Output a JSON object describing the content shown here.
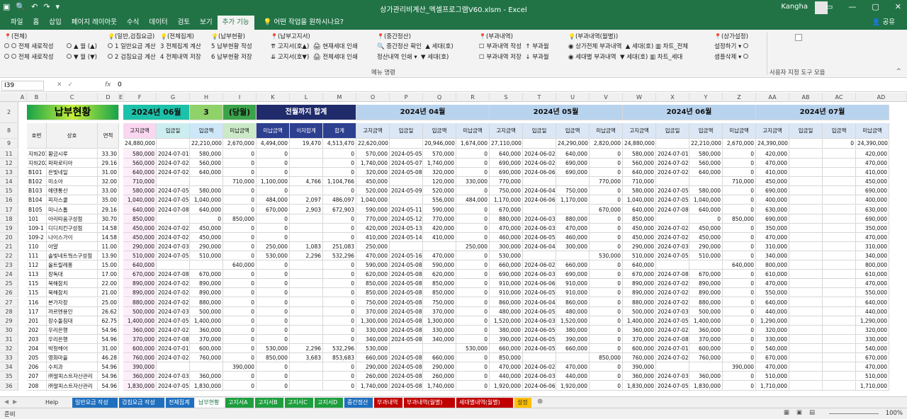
{
  "window": {
    "title": "상가관리비계산_엑셀프로그램V60.xlsm  -  Excel",
    "user": "Kangha"
  },
  "ribbon_tabs": [
    "파일",
    "홈",
    "삽입",
    "페이지 레이아웃",
    "수식",
    "데이터",
    "검토",
    "보기",
    "추가 기능"
  ],
  "tell_me": "어떤 작업을 원하시나요?",
  "share": "공유",
  "ribbon": {
    "row0": [
      "(전체)",
      "(일반,검침요금)",
      "(전체집계)",
      "(납부현황)",
      "(납부고지서)",
      "(중간정산)",
      "(부과내역)",
      "(부과내역(월별))",
      "(상가설정)"
    ],
    "row1": [
      "전체 새로작성",
      "월 (▲)",
      "1 일반요금 계산",
      "3 전체집계 계산",
      "5 납부현황 작성",
      "고지서(호▲)",
      "현재세대 인쇄",
      "중간정산 확인",
      "세대(호)",
      "부과내역 작성",
      "부과월",
      "상가전체 부과내역",
      "세대(호)",
      "차트_전체",
      "설정하기"
    ],
    "row2": [
      "전체 새로작성",
      "월 (▼)",
      "2 검침요금 계산",
      "4 전체내역 저장",
      "6 납부현황 저장",
      "고지서(호▼)",
      "전체세대 인쇄",
      "정산내역 인쇄",
      "세대(호)",
      "부과내역 저장",
      "부과월",
      "세대별 부과내역",
      "세대(호)",
      "차트_세대",
      "샘플삭제"
    ],
    "menu_label": "메뉴 명령",
    "custom_label": "사용자 지정 도구 모음"
  },
  "namebox": "I39",
  "formula": "0",
  "columns": [
    "A",
    "B",
    "C",
    "D",
    "E",
    "F",
    "G",
    "H",
    "I",
    "K",
    "L",
    "M",
    "O",
    "P",
    "Q",
    "R",
    "S",
    "T",
    "U",
    "V",
    "W",
    "X",
    "Y",
    "Z",
    "AA",
    "AB",
    "AC",
    "AD"
  ],
  "header": {
    "title": "납부현황",
    "month_label": "2024년 06월",
    "month_no": "3",
    "current": "(당월)",
    "total_label": "전월까지 합계",
    "m1": "2024년 04월",
    "m2": "2024년 05월",
    "m3": "2024년 06월",
    "m4": "2024년 07월"
  },
  "subhead": {
    "ho": "호번",
    "name": "상호",
    "area": "면적",
    "cols": [
      "고지금액",
      "입금일",
      "입금액",
      "미납금액"
    ],
    "tot": [
      "미납금액",
      "이자합계",
      "합계"
    ]
  },
  "totals": {
    "f": "24,880,000",
    "h": "22,210,000",
    "i": "2,670,000",
    "k": "4,494,000",
    "l": "19,470",
    "m": "4,513,470",
    "o": "22,620,000",
    "q": "20,946,000",
    "r": "1,674,000",
    "s": "27,110,000",
    "u": "24,290,000",
    "v": "2,820,000",
    "w": "24,880,000",
    "y": "22,210,000",
    "z": "2,670,000",
    "aa": "24,390,000",
    "ac": "0",
    "ad": "24,390,000"
  },
  "rows": [
    {
      "rn": "11",
      "ho": "지하201",
      "nm": "황금시루",
      "ar": "33.30",
      "f": "580,000",
      "g": "2024-07-01",
      "h": "580,000",
      "i": "0",
      "k": "0",
      "l": "",
      "m": "0",
      "o": "570,000",
      "p": "2024-05-05",
      "q": "570,000",
      "r": "0",
      "s": "640,000",
      "t": "2024-06-02",
      "u": "640,000",
      "v": "0",
      "w": "580,000",
      "x": "2024-07-01",
      "y": "580,000",
      "z": "0",
      "aa": "420,000",
      "ad": "420,000"
    },
    {
      "rn": "12",
      "ho": "지하202",
      "nm": "파파로티아",
      "ar": "29.16",
      "f": "560,000",
      "g": "2024-07-02",
      "h": "560,000",
      "i": "0",
      "k": "0",
      "l": "",
      "m": "0",
      "o": "1,740,000",
      "p": "2024-05-07",
      "q": "1,740,000",
      "r": "0",
      "s": "690,000",
      "t": "2024-06-02",
      "u": "690,000",
      "v": "0",
      "w": "560,000",
      "x": "2024-07-02",
      "y": "560,000",
      "z": "0",
      "aa": "470,000",
      "ad": "470,000"
    },
    {
      "rn": "13",
      "ho": "B101",
      "nm": "은빛네일",
      "ar": "31.00",
      "f": "640,000",
      "g": "2024-07-02",
      "h": "640,000",
      "i": "0",
      "k": "0",
      "l": "",
      "m": "0",
      "o": "320,000",
      "p": "2024-05-08",
      "q": "320,000",
      "r": "0",
      "s": "690,000",
      "t": "2024-06-06",
      "u": "690,000",
      "v": "0",
      "w": "640,000",
      "x": "2024-07-02",
      "y": "640,000",
      "z": "0",
      "aa": "410,000",
      "ad": "410,000"
    },
    {
      "rn": "14",
      "ho": "B102",
      "nm": "미소야",
      "ar": "32.00",
      "f": "710,000",
      "g": "",
      "h": "",
      "i": "710,000",
      "k": "1,100,000",
      "l": "4,766",
      "m": "1,104,766",
      "o": "450,000",
      "p": "",
      "q": "120,000",
      "r": "330,000",
      "s": "770,000",
      "t": "",
      "u": "",
      "v": "770,000",
      "w": "710,000",
      "x": "",
      "y": "",
      "z": "710,000",
      "aa": "450,000",
      "ad": "450,000"
    },
    {
      "rn": "15",
      "ho": "B103",
      "nm": "에덴통신",
      "ar": "33.00",
      "f": "580,000",
      "g": "2024-07-05",
      "h": "580,000",
      "i": "0",
      "k": "0",
      "l": "",
      "m": "0",
      "o": "520,000",
      "p": "2024-05-09",
      "q": "520,000",
      "r": "0",
      "s": "750,000",
      "t": "2024-06-04",
      "u": "750,000",
      "v": "0",
      "w": "580,000",
      "x": "2024-07-05",
      "y": "580,000",
      "z": "0",
      "aa": "690,000",
      "ad": "690,000"
    },
    {
      "rn": "16",
      "ho": "B104",
      "nm": "피자스쿨",
      "ar": "35.00",
      "f": "1,040,000",
      "g": "2024-07-05",
      "h": "1,040,000",
      "i": "0",
      "k": "484,000",
      "l": "2,097",
      "m": "486,097",
      "o": "1,040,000",
      "p": "",
      "q": "556,000",
      "r": "484,000",
      "s": "1,170,000",
      "t": "2024-06-06",
      "u": "1,170,000",
      "v": "0",
      "w": "1,040,000",
      "x": "2024-07-05",
      "y": "1,040,000",
      "z": "0",
      "aa": "400,000",
      "ad": "400,000"
    },
    {
      "rn": "17",
      "ho": "B105",
      "nm": "미니스톱",
      "ar": "29.16",
      "f": "640,000",
      "g": "2024-07-08",
      "h": "640,000",
      "i": "0",
      "k": "670,000",
      "l": "2,903",
      "m": "672,903",
      "o": "590,000",
      "p": "2024-05-11",
      "q": "590,000",
      "r": "0",
      "s": "670,000",
      "t": "",
      "u": "",
      "v": "670,000",
      "w": "640,000",
      "x": "2024-07-08",
      "y": "640,000",
      "z": "0",
      "aa": "630,000",
      "ad": "630,000"
    },
    {
      "rn": "18",
      "ho": "101",
      "nm": "아리따움구성점",
      "ar": "30.70",
      "f": "850,000",
      "g": "",
      "h": "0",
      "i": "850,000",
      "k": "0",
      "l": "",
      "m": "0",
      "o": "770,000",
      "p": "2024-05-12",
      "q": "770,000",
      "r": "0",
      "s": "880,000",
      "t": "2024-06-03",
      "u": "880,000",
      "v": "0",
      "w": "850,000",
      "x": "",
      "y": "0",
      "z": "850,000",
      "aa": "690,000",
      "ad": "690,000"
    },
    {
      "rn": "19",
      "ho": "109-1",
      "nm": "디디치킨구성점",
      "ar": "14.58",
      "f": "450,000",
      "g": "2024-07-02",
      "h": "450,000",
      "i": "0",
      "k": "0",
      "l": "",
      "m": "0",
      "o": "420,000",
      "p": "2024-05-13",
      "q": "420,000",
      "r": "0",
      "s": "470,000",
      "t": "2024-06-03",
      "u": "470,000",
      "v": "0",
      "w": "450,000",
      "x": "2024-07-02",
      "y": "450,000",
      "z": "0",
      "aa": "350,000",
      "ad": "350,000"
    },
    {
      "rn": "20",
      "ho": "109-2",
      "nm": "나이스가이",
      "ar": "14.58",
      "f": "450,000",
      "g": "2024-07-02",
      "h": "450,000",
      "i": "0",
      "k": "0",
      "l": "",
      "m": "0",
      "o": "410,000",
      "p": "2024-05-14",
      "q": "410,000",
      "r": "0",
      "s": "460,000",
      "t": "2024-06-05",
      "u": "460,000",
      "v": "0",
      "w": "450,000",
      "x": "2024-07-02",
      "y": "450,000",
      "z": "0",
      "aa": "470,000",
      "ad": "470,000"
    },
    {
      "rn": "21",
      "ho": "110",
      "nm": "아얄",
      "ar": "11.00",
      "f": "290,000",
      "g": "2024-07-03",
      "h": "290,000",
      "i": "0",
      "k": "250,000",
      "l": "1,083",
      "m": "251,083",
      "o": "250,000",
      "p": "",
      "q": "",
      "r": "250,000",
      "s": "300,000",
      "t": "2024-06-04",
      "u": "300,000",
      "v": "0",
      "w": "290,000",
      "x": "2024-07-03",
      "y": "290,000",
      "z": "0",
      "aa": "310,000",
      "ad": "310,000"
    },
    {
      "rn": "22",
      "ho": "111",
      "nm": "솔빛네트웍스구성점",
      "ar": "13.90",
      "f": "510,000",
      "g": "2024-07-05",
      "h": "510,000",
      "i": "0",
      "k": "530,000",
      "l": "2,296",
      "m": "532,296",
      "o": "470,000",
      "p": "2024-05-16",
      "q": "470,000",
      "r": "0",
      "s": "530,000",
      "t": "",
      "u": "",
      "v": "530,000",
      "w": "510,000",
      "x": "2024-07-05",
      "y": "510,000",
      "z": "0",
      "aa": "340,000",
      "ad": "340,000"
    },
    {
      "rn": "23",
      "ho": "112",
      "nm": "올트릴레홍",
      "ar": "15.00",
      "f": "640,000",
      "g": "",
      "h": "",
      "i": "640,000",
      "k": "0",
      "l": "",
      "m": "0",
      "o": "590,000",
      "p": "2024-05-08",
      "q": "590,000",
      "r": "0",
      "s": "660,000",
      "t": "2024-06-02",
      "u": "660,000",
      "v": "0",
      "w": "640,000",
      "x": "",
      "y": "",
      "z": "640,000",
      "aa": "800,000",
      "ad": "800,000"
    },
    {
      "rn": "24",
      "ho": "113",
      "nm": "장독대",
      "ar": "17.00",
      "f": "670,000",
      "g": "2024-07-08",
      "h": "670,000",
      "i": "0",
      "k": "0",
      "l": "",
      "m": "0",
      "o": "620,000",
      "p": "2024-05-08",
      "q": "620,000",
      "r": "0",
      "s": "690,000",
      "t": "2024-06-03",
      "u": "690,000",
      "v": "0",
      "w": "670,000",
      "x": "2024-07-08",
      "y": "670,000",
      "z": "0",
      "aa": "610,000",
      "ad": "610,000"
    },
    {
      "rn": "25",
      "ho": "115",
      "nm": "북해참치",
      "ar": "22.00",
      "f": "890,000",
      "g": "2024-07-02",
      "h": "890,000",
      "i": "0",
      "k": "0",
      "l": "",
      "m": "0",
      "o": "850,000",
      "p": "2024-05-08",
      "q": "850,000",
      "r": "0",
      "s": "910,000",
      "t": "2024-06-06",
      "u": "910,000",
      "v": "0",
      "w": "890,000",
      "x": "2024-07-02",
      "y": "890,000",
      "z": "0",
      "aa": "470,000",
      "ad": "470,000"
    },
    {
      "rn": "26",
      "ho": "115",
      "nm": "북해참치",
      "ar": "21.00",
      "f": "890,000",
      "g": "2024-07-02",
      "h": "890,000",
      "i": "0",
      "k": "0",
      "l": "",
      "m": "0",
      "o": "850,000",
      "p": "2024-05-08",
      "q": "850,000",
      "r": "0",
      "s": "910,000",
      "t": "2024-06-05",
      "u": "910,000",
      "v": "0",
      "w": "890,000",
      "x": "2024-07-02",
      "y": "890,000",
      "z": "0",
      "aa": "550,000",
      "ad": "550,000"
    },
    {
      "rn": "27",
      "ho": "116",
      "nm": "본가자장",
      "ar": "25.00",
      "f": "880,000",
      "g": "2024-07-02",
      "h": "880,000",
      "i": "0",
      "k": "0",
      "l": "",
      "m": "0",
      "o": "750,000",
      "p": "2024-05-08",
      "q": "750,000",
      "r": "0",
      "s": "860,000",
      "t": "2024-06-04",
      "u": "860,000",
      "v": "0",
      "w": "880,000",
      "x": "2024-07-02",
      "y": "880,000",
      "z": "0",
      "aa": "640,000",
      "ad": "640,000"
    },
    {
      "rn": "28",
      "ho": "117",
      "nm": "까르멘용인",
      "ar": "26.62",
      "f": "500,000",
      "g": "2024-07-03",
      "h": "500,000",
      "i": "0",
      "k": "0",
      "l": "",
      "m": "0",
      "o": "370,000",
      "p": "2024-05-08",
      "q": "370,000",
      "r": "0",
      "s": "480,000",
      "t": "2024-06-05",
      "u": "480,000",
      "v": "0",
      "w": "500,000",
      "x": "2024-07-03",
      "y": "500,000",
      "z": "0",
      "aa": "440,000",
      "ad": "440,000"
    },
    {
      "rn": "29",
      "ho": "201",
      "nm": "장수돌침대",
      "ar": "62.75",
      "f": "1,400,000",
      "g": "2024-07-05",
      "h": "1,400,000",
      "i": "0",
      "k": "0",
      "l": "",
      "m": "0",
      "o": "1,300,000",
      "p": "2024-05-08",
      "q": "1,300,000",
      "r": "0",
      "s": "1,520,000",
      "t": "2024-06-03",
      "u": "1,520,000",
      "v": "0",
      "w": "1,400,000",
      "x": "2024-07-05",
      "y": "1,400,000",
      "z": "0",
      "aa": "1,290,000",
      "ad": "1,290,000"
    },
    {
      "rn": "30",
      "ho": "202",
      "nm": "우리은행",
      "ar": "54.96",
      "f": "360,000",
      "g": "2024-07-02",
      "h": "360,000",
      "i": "0",
      "k": "0",
      "l": "",
      "m": "0",
      "o": "330,000",
      "p": "2024-05-08",
      "q": "330,000",
      "r": "0",
      "s": "380,000",
      "t": "2024-06-05",
      "u": "380,000",
      "v": "0",
      "w": "360,000",
      "x": "2024-07-02",
      "y": "360,000",
      "z": "0",
      "aa": "320,000",
      "ad": "320,000"
    },
    {
      "rn": "31",
      "ho": "203",
      "nm": "우리은행",
      "ar": "54.96",
      "f": "370,000",
      "g": "2024-07-08",
      "h": "370,000",
      "i": "0",
      "k": "0",
      "l": "",
      "m": "0",
      "o": "340,000",
      "p": "2024-05-08",
      "q": "340,000",
      "r": "0",
      "s": "390,000",
      "t": "2024-06-05",
      "u": "390,000",
      "v": "0",
      "w": "370,000",
      "x": "2024-07-08",
      "y": "370,000",
      "z": "0",
      "aa": "330,000",
      "ad": "330,000"
    },
    {
      "rn": "32",
      "ho": "204",
      "nm": "박청헤어",
      "ar": "31.00",
      "f": "600,000",
      "g": "2024-07-01",
      "h": "600,000",
      "i": "0",
      "k": "530,000",
      "l": "2,296",
      "m": "532,296",
      "o": "530,000",
      "p": "",
      "q": "",
      "r": "530,000",
      "s": "660,000",
      "t": "2024-06-05",
      "u": "660,000",
      "v": "0",
      "w": "600,000",
      "x": "2024-07-01",
      "y": "600,000",
      "z": "0",
      "aa": "540,000",
      "ad": "540,000"
    },
    {
      "rn": "33",
      "ho": "205",
      "nm": "영화마을",
      "ar": "46.28",
      "f": "760,000",
      "g": "2024-07-02",
      "h": "760,000",
      "i": "0",
      "k": "850,000",
      "l": "3,683",
      "m": "853,683",
      "o": "660,000",
      "p": "2024-05-08",
      "q": "660,000",
      "r": "0",
      "s": "850,000",
      "t": "",
      "u": "",
      "v": "850,000",
      "w": "760,000",
      "x": "2024-07-02",
      "y": "760,000",
      "z": "0",
      "aa": "670,000",
      "ad": "670,000"
    },
    {
      "rn": "34",
      "ho": "206",
      "nm": "수치과",
      "ar": "54.96",
      "f": "390,000",
      "g": "",
      "h": "",
      "i": "390,000",
      "k": "0",
      "l": "",
      "m": "0",
      "o": "290,000",
      "p": "2024-05-08",
      "q": "290,000",
      "r": "0",
      "s": "470,000",
      "t": "2024-06-02",
      "u": "470,000",
      "v": "0",
      "w": "390,000",
      "x": "",
      "y": "",
      "z": "390,000",
      "aa": "470,000",
      "ad": "470,000"
    },
    {
      "rn": "35",
      "ho": "207",
      "nm": "㈜알피스트자산관리",
      "ar": "54.96",
      "f": "360,000",
      "g": "2024-07-03",
      "h": "360,000",
      "i": "0",
      "k": "0",
      "l": "",
      "m": "0",
      "o": "260,000",
      "p": "2024-05-08",
      "q": "260,000",
      "r": "0",
      "s": "440,000",
      "t": "2024-06-03",
      "u": "440,000",
      "v": "0",
      "w": "360,000",
      "x": "2024-07-03",
      "y": "360,000",
      "z": "0",
      "aa": "510,000",
      "ad": "510,000"
    },
    {
      "rn": "36",
      "ho": "208",
      "nm": "㈜알피스트자산관리",
      "ar": "54.96",
      "f": "1,830,000",
      "g": "2024-07-05",
      "h": "1,830,000",
      "i": "0",
      "k": "0",
      "l": "",
      "m": "0",
      "o": "1,740,000",
      "p": "2024-05-08",
      "q": "1,740,000",
      "r": "0",
      "s": "1,920,000",
      "t": "2024-06-06",
      "u": "1,920,000",
      "v": "0",
      "w": "1,830,000",
      "x": "2024-07-05",
      "y": "1,830,000",
      "z": "0",
      "aa": "1,710,000",
      "ad": "1,710,000"
    }
  ],
  "sheet_tabs": [
    {
      "label": "Help",
      "color": "#f0f0f0",
      "fg": "#333"
    },
    {
      "label": "일반요금 작성",
      "color": "#1f6fbf",
      "fg": "#fff"
    },
    {
      "label": "검침요금 작성",
      "color": "#1f6fbf",
      "fg": "#fff"
    },
    {
      "label": "전체집계",
      "color": "#1f6fbf",
      "fg": "#fff"
    },
    {
      "label": "납부현황",
      "color": "#ffffff",
      "fg": "#217346"
    },
    {
      "label": "고지서A",
      "color": "#1e9e3e",
      "fg": "#fff"
    },
    {
      "label": "고지서B",
      "color": "#1e9e3e",
      "fg": "#fff"
    },
    {
      "label": "고지서C",
      "color": "#1e9e3e",
      "fg": "#fff"
    },
    {
      "label": "고지서D",
      "color": "#1e9e3e",
      "fg": "#fff"
    },
    {
      "label": "중간정산",
      "color": "#1f6fbf",
      "fg": "#fff"
    },
    {
      "label": "부과내역",
      "color": "#c00000",
      "fg": "#fff"
    },
    {
      "label": "부과내역(월별)",
      "color": "#c00000",
      "fg": "#fff"
    },
    {
      "label": "세대별내역(월별)",
      "color": "#c00000",
      "fg": "#fff"
    },
    {
      "label": "설정",
      "color": "#ffc000",
      "fg": "#333"
    }
  ],
  "status": {
    "ready": "준비",
    "zoom": "100%"
  }
}
